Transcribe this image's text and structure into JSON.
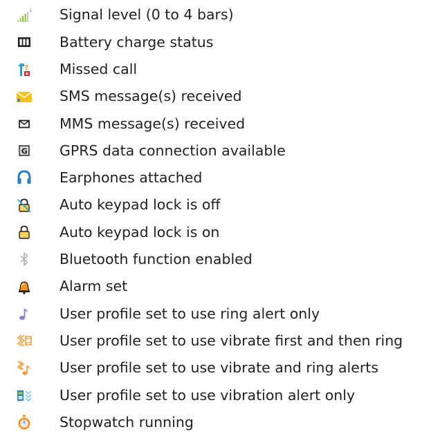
{
  "legend": {
    "items": [
      {
        "icon": "signal-level-icon",
        "label": "Signal level (0 to 4 bars)"
      },
      {
        "icon": "battery-icon",
        "label": "Battery charge status"
      },
      {
        "icon": "missed-call-icon",
        "label": "Missed call"
      },
      {
        "icon": "sms-envelope-icon",
        "label": "SMS message(s) received"
      },
      {
        "icon": "mms-envelope-icon",
        "label": "MMS message(s) received"
      },
      {
        "icon": "gprs-icon",
        "label": "GPRS data connection available"
      },
      {
        "icon": "earphones-icon",
        "label": "Earphones attached"
      },
      {
        "icon": "keypad-lock-off-icon",
        "label": "Auto keypad lock is off"
      },
      {
        "icon": "keypad-lock-on-icon",
        "label": "Auto keypad lock is on"
      },
      {
        "icon": "bluetooth-icon",
        "label": "Bluetooth function enabled"
      },
      {
        "icon": "alarm-bell-icon",
        "label": "Alarm set"
      },
      {
        "icon": "ring-note-icon",
        "label": "User profile set to use ring alert only"
      },
      {
        "icon": "vibrate-then-ring-icon",
        "label": "User profile set to use vibrate first and then ring"
      },
      {
        "icon": "vibrate-and-ring-icon",
        "label": "User profile set to use vibrate and ring alerts"
      },
      {
        "icon": "vibration-only-icon",
        "label": "User profile set to use vibration alert only"
      },
      {
        "icon": "stopwatch-icon",
        "label": "Stopwatch running"
      }
    ]
  },
  "colors": {
    "text": "#231f20",
    "signal_green": "#8cc63f",
    "envelope_yellow": "#f7c11b",
    "earphones_blue": "#2a7fc2",
    "lock_yellow": "#f9d35b",
    "alarm_orange": "#f7941d",
    "note_purple": "#8a7ec8",
    "vibrate_orange": "#f0a040",
    "missed_red": "#d8232a"
  }
}
